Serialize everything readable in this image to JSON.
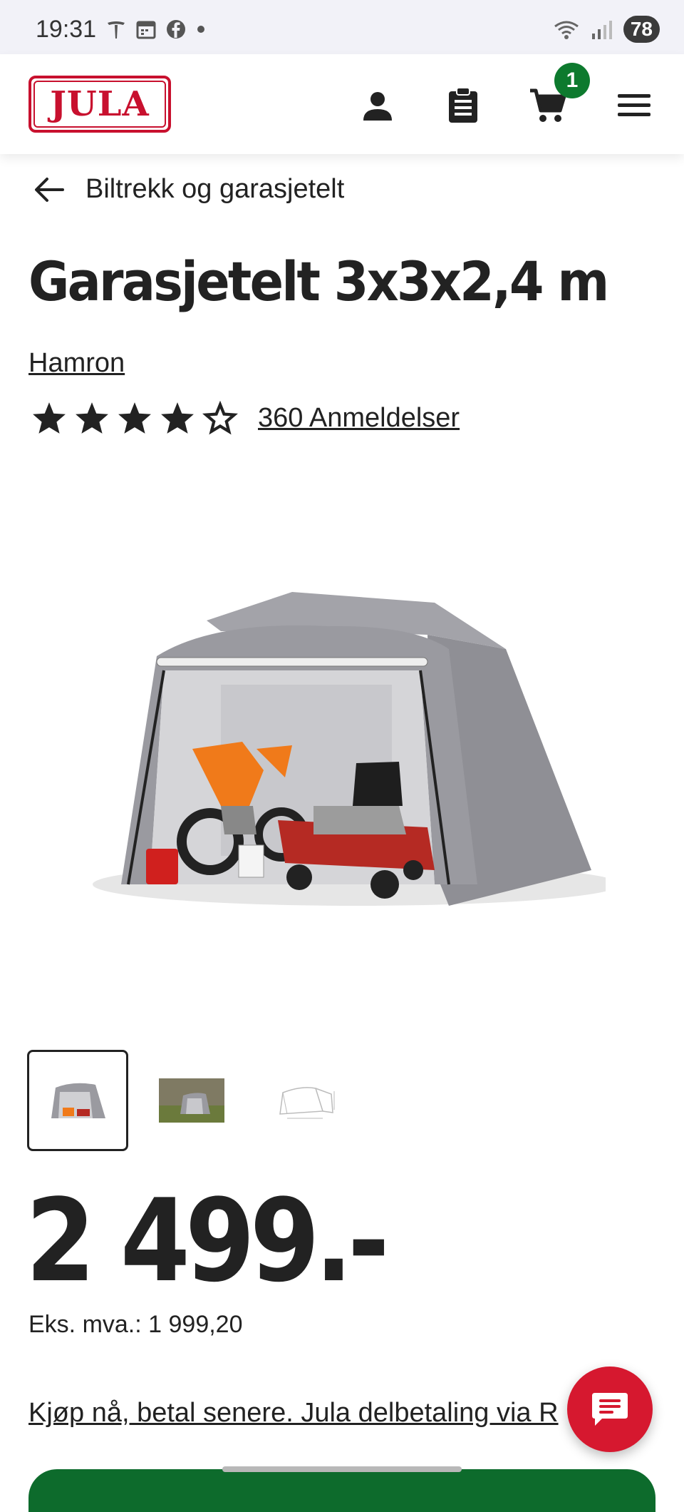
{
  "status_bar": {
    "time": "19:31",
    "battery": "78",
    "icons_left": [
      "tesla-icon",
      "calendar-icon",
      "facebook-icon",
      "dot-icon"
    ],
    "icons_right": [
      "wifi-icon",
      "signal-icon"
    ]
  },
  "header": {
    "logo_text": "JULA",
    "icons": [
      "account-icon",
      "clipboard-icon",
      "cart-icon",
      "menu-icon"
    ],
    "cart_count": "1"
  },
  "breadcrumb": {
    "label": "Biltrekk og garasjetelt"
  },
  "product": {
    "title": "Garasjetelt 3x3x2,4 m",
    "brand": "Hamron",
    "rating": 4,
    "rating_max": 5,
    "reviews_label": "360 Anmeldelser",
    "price": "2 499.-",
    "price_ex_vat": "Eks. mva.: 1 999,20",
    "installment_text": "Kjøp nå, betal senere. Jula delbetaling via R"
  },
  "thumbnails": [
    {
      "name": "thumbnail-tent-front",
      "selected": true
    },
    {
      "name": "thumbnail-tent-outdoor",
      "selected": false
    },
    {
      "name": "thumbnail-tent-drawing",
      "selected": false
    }
  ],
  "colors": {
    "brand_red": "#c8102e",
    "badge_green": "#0d7a2e",
    "chat_red": "#d6182f",
    "cta_green": "#0d6b2c"
  }
}
